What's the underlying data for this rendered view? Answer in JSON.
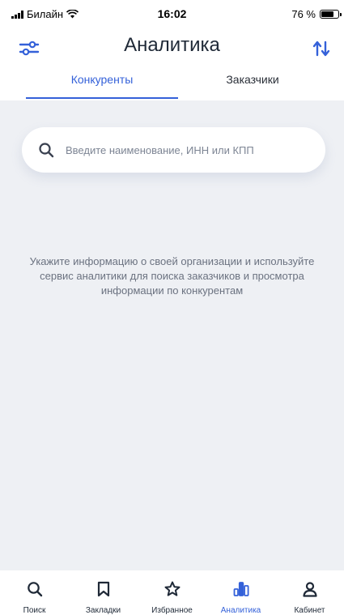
{
  "status_bar": {
    "carrier": "Билайн",
    "time": "16:02",
    "battery": "76 %",
    "battery_level": 0.76
  },
  "header": {
    "title": "Аналитика",
    "filter_icon": "sliders-icon",
    "sort_icon": "sort-arrows-icon"
  },
  "tabs": [
    {
      "label": "Конкуренты",
      "active": true
    },
    {
      "label": "Заказчики",
      "active": false
    }
  ],
  "search": {
    "placeholder": "Введите наименование, ИНН или КПП",
    "value": "",
    "icon": "search-icon"
  },
  "info_text": "Укажите информацию о своей организации и используйте сервис аналитики для поиска заказчиков и просмотра информации по конкурентам",
  "bottom_nav": [
    {
      "label": "Поиск",
      "icon": "search-icon",
      "active": false
    },
    {
      "label": "Закладки",
      "icon": "bookmark-icon",
      "active": false
    },
    {
      "label": "Избранное",
      "icon": "star-icon",
      "active": false
    },
    {
      "label": "Аналитика",
      "icon": "bar-chart-icon",
      "active": true
    },
    {
      "label": "Кабинет",
      "icon": "user-icon",
      "active": false
    }
  ],
  "colors": {
    "accent": "#3461d9",
    "background": "#eef0f4"
  }
}
